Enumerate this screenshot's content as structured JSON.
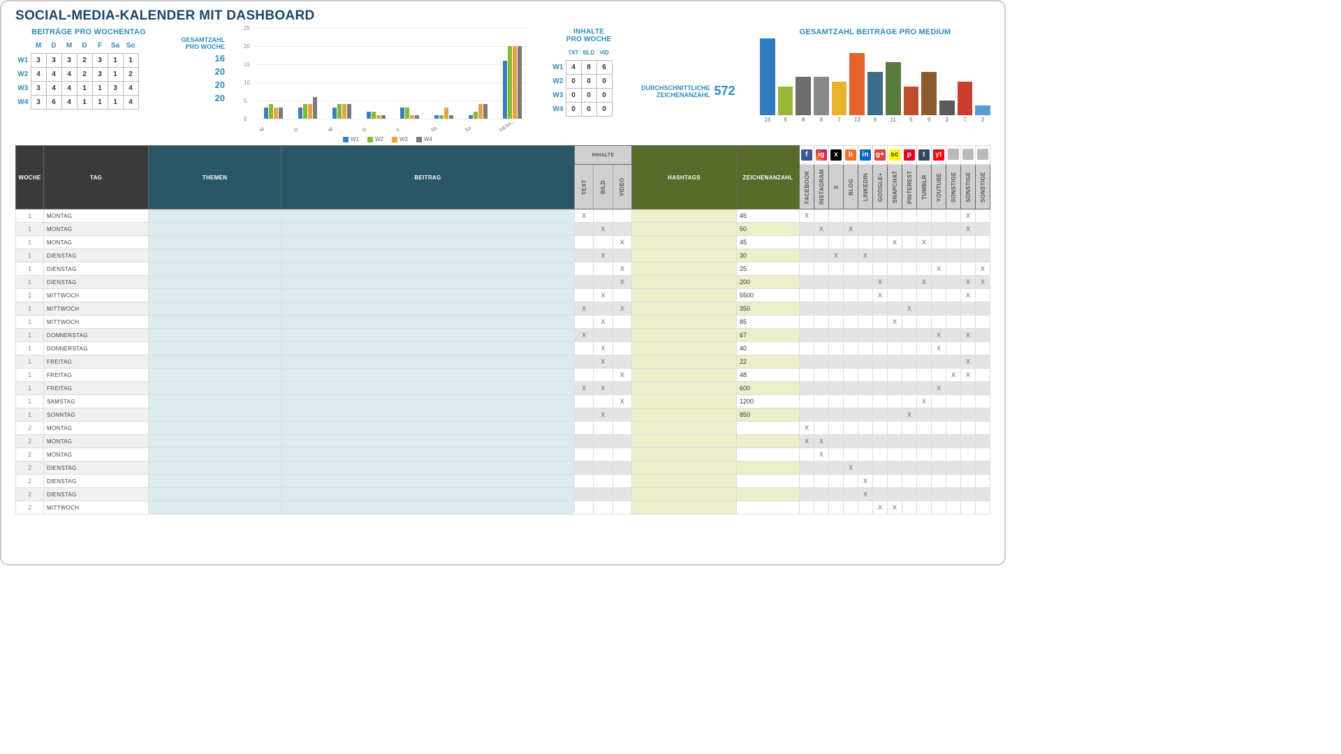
{
  "title": "SOCIAL-MEDIA-KALENDER MIT DASHBOARD",
  "weekday": {
    "title": "BEITRÄGE PRO WOCHENTAG",
    "cols": [
      "M",
      "D",
      "M",
      "D",
      "F",
      "Sa",
      "So"
    ],
    "rows": [
      {
        "label": "W1",
        "vals": [
          3,
          3,
          3,
          2,
          3,
          1,
          1
        ]
      },
      {
        "label": "W2",
        "vals": [
          4,
          4,
          4,
          2,
          3,
          1,
          2
        ]
      },
      {
        "label": "W3",
        "vals": [
          3,
          4,
          4,
          1,
          1,
          3,
          4
        ]
      },
      {
        "label": "W4",
        "vals": [
          3,
          6,
          4,
          1,
          1,
          1,
          4
        ]
      }
    ]
  },
  "totals": {
    "label": "GESAMTZAHL\nPRO WOCHE",
    "vals": [
      16,
      20,
      20,
      20
    ]
  },
  "chart_data": {
    "type": "bar",
    "title": "",
    "ylim": [
      0,
      25
    ],
    "ticks": [
      0,
      5,
      10,
      15,
      20,
      25
    ],
    "categories": [
      "M",
      "D",
      "M",
      "D",
      "F",
      "Sa",
      "So",
      "GESA..."
    ],
    "series": [
      {
        "name": "W1",
        "values": [
          3,
          3,
          3,
          2,
          3,
          1,
          1,
          16
        ]
      },
      {
        "name": "W2",
        "values": [
          4,
          4,
          4,
          2,
          3,
          1,
          2,
          20
        ]
      },
      {
        "name": "W3",
        "values": [
          3,
          4,
          4,
          1,
          1,
          3,
          4,
          20
        ]
      },
      {
        "name": "W4",
        "values": [
          3,
          6,
          4,
          1,
          1,
          1,
          4,
          20
        ]
      }
    ]
  },
  "inhalte": {
    "title": "INHALTE\nPRO WOCHE",
    "cols": [
      "TXT",
      "BLD",
      "VID"
    ],
    "rows": [
      {
        "label": "W1",
        "vals": [
          4,
          8,
          6
        ]
      },
      {
        "label": "W2",
        "vals": [
          0,
          0,
          0
        ]
      },
      {
        "label": "W3",
        "vals": [
          0,
          0,
          0
        ]
      },
      {
        "label": "W4",
        "vals": [
          0,
          0,
          0
        ]
      }
    ]
  },
  "avg": {
    "label": "DURCHSCHNITTLICHE\nZEICHENANZAHL",
    "val": "572"
  },
  "medium": {
    "title": "GESAMTZAHL BEITRÄGE PRO MEDIUM",
    "values": [
      16,
      6,
      8,
      8,
      7,
      13,
      9,
      11,
      6,
      9,
      3,
      7,
      2
    ]
  },
  "table": {
    "headers": {
      "woche": "WOCHE",
      "tag": "TAG",
      "themen": "THEMEN",
      "beitrag": "BEITRAG",
      "inhalte": "INHALTE",
      "text": "TEXT",
      "bild": "BILD",
      "video": "VIDEO",
      "hashtags": "HASHTAGS",
      "zeichen": "ZEICHENANZAHL",
      "channels": [
        "FACEBOOK",
        "INSTAGRAM",
        "X",
        "BLOG",
        "LINKEDIN",
        "GOOGLE+",
        "SNAPCHAT",
        "PINTEREST",
        "TUMBLR",
        "YOUTUBE",
        "SONSTIGE",
        "SONSTIGE",
        "SONSTIGE"
      ]
    },
    "icons": [
      "f",
      "ig",
      "x",
      "b",
      "in",
      "g+",
      "sc",
      "p",
      "t",
      "yt",
      "",
      "",
      " "
    ],
    "rows": [
      {
        "w": 1,
        "day": "MONTAG",
        "t": "X",
        "b": "",
        "v": "",
        "z": "45",
        "c": [
          "X",
          "",
          "",
          "",
          "",
          "",
          "",
          "",
          "",
          "",
          "",
          "X",
          ""
        ]
      },
      {
        "w": 1,
        "day": "MONTAG",
        "t": "",
        "b": "X",
        "v": "",
        "z": "50",
        "c": [
          "",
          "X",
          "",
          "X",
          "",
          "",
          "",
          "",
          "",
          "",
          "",
          "X",
          ""
        ]
      },
      {
        "w": 1,
        "day": "MONTAG",
        "t": "",
        "b": "",
        "v": "X",
        "z": "45",
        "c": [
          "",
          "",
          "",
          "",
          "",
          "",
          "X",
          "",
          "X",
          "",
          "",
          "",
          ""
        ]
      },
      {
        "w": 1,
        "day": "DIENSTAG",
        "t": "",
        "b": "X",
        "v": "",
        "z": "30",
        "c": [
          "",
          "",
          "X",
          "",
          "X",
          "",
          "",
          "",
          "",
          "",
          "",
          "",
          ""
        ]
      },
      {
        "w": 1,
        "day": "DIENSTAG",
        "t": "",
        "b": "",
        "v": "X",
        "z": "25",
        "c": [
          "",
          "",
          "",
          "",
          "",
          "",
          "",
          "",
          "",
          "X",
          "",
          "",
          "X"
        ]
      },
      {
        "w": 1,
        "day": "DIENSTAG",
        "t": "",
        "b": "",
        "v": "X",
        "z": "200",
        "c": [
          "",
          "",
          "",
          "",
          "",
          "X",
          "",
          "",
          "X",
          "",
          "",
          "X",
          "X"
        ]
      },
      {
        "w": 1,
        "day": "MITTWOCH",
        "t": "",
        "b": "X",
        "v": "",
        "z": "5500",
        "c": [
          "",
          "",
          "",
          "",
          "",
          "X",
          "",
          "",
          "",
          "",
          "",
          "X",
          ""
        ]
      },
      {
        "w": 1,
        "day": "MITTWOCH",
        "t": "X",
        "b": "",
        "v": "X",
        "z": "350",
        "c": [
          "",
          "",
          "",
          "",
          "",
          "",
          "",
          "X",
          "",
          "",
          "",
          "",
          ""
        ]
      },
      {
        "w": 1,
        "day": "MITTWOCH",
        "t": "",
        "b": "X",
        "v": "",
        "z": "85",
        "c": [
          "",
          "",
          "",
          "",
          "",
          "",
          "X",
          "",
          "",
          "",
          "",
          "",
          ""
        ]
      },
      {
        "w": 1,
        "day": "DONNERSTAG",
        "t": "X",
        "b": "",
        "v": "",
        "z": "67",
        "c": [
          "",
          "",
          "",
          "",
          "",
          "",
          "",
          "",
          "",
          "X",
          "",
          "X",
          ""
        ]
      },
      {
        "w": 1,
        "day": "DONNERSTAG",
        "t": "",
        "b": "X",
        "v": "",
        "z": "40",
        "c": [
          "",
          "",
          "",
          "",
          "",
          "",
          "",
          "",
          "",
          "X",
          "",
          "",
          ""
        ]
      },
      {
        "w": 1,
        "day": "FREITAG",
        "t": "",
        "b": "X",
        "v": "",
        "z": "22",
        "c": [
          "",
          "",
          "",
          "",
          "",
          "",
          "",
          "",
          "",
          "",
          "",
          "X",
          ""
        ]
      },
      {
        "w": 1,
        "day": "FREITAG",
        "t": "",
        "b": "",
        "v": "X",
        "z": "48",
        "c": [
          "",
          "",
          "",
          "",
          "",
          "",
          "",
          "",
          "",
          "",
          "X",
          "X",
          ""
        ]
      },
      {
        "w": 1,
        "day": "FREITAG",
        "t": "X",
        "b": "X",
        "v": "",
        "z": "600",
        "c": [
          "",
          "",
          "",
          "",
          "",
          "",
          "",
          "",
          "",
          "X",
          "",
          "",
          ""
        ]
      },
      {
        "w": 1,
        "day": "SAMSTAG",
        "t": "",
        "b": "",
        "v": "X",
        "z": "1200",
        "c": [
          "",
          "",
          "",
          "",
          "",
          "",
          "",
          "",
          "X",
          "",
          "",
          "",
          ""
        ]
      },
      {
        "w": 1,
        "day": "SONNTAG",
        "t": "",
        "b": "X",
        "v": "",
        "z": "850",
        "c": [
          "",
          "",
          "",
          "",
          "",
          "",
          "",
          "X",
          "",
          "",
          "",
          "",
          ""
        ]
      },
      {
        "w": 2,
        "day": "MONTAG",
        "t": "",
        "b": "",
        "v": "",
        "z": "",
        "c": [
          "X",
          "",
          "",
          "",
          "",
          "",
          "",
          "",
          "",
          "",
          "",
          "",
          ""
        ]
      },
      {
        "w": 2,
        "day": "MONTAG",
        "t": "",
        "b": "",
        "v": "",
        "z": "",
        "c": [
          "X",
          "X",
          "",
          "",
          "",
          "",
          "",
          "",
          "",
          "",
          "",
          "",
          ""
        ]
      },
      {
        "w": 2,
        "day": "MONTAG",
        "t": "",
        "b": "",
        "v": "",
        "z": "",
        "c": [
          "",
          "X",
          "",
          "",
          "",
          "",
          "",
          "",
          "",
          "",
          "",
          "",
          ""
        ]
      },
      {
        "w": 2,
        "day": "DIENSTAG",
        "t": "",
        "b": "",
        "v": "",
        "z": "",
        "c": [
          "",
          "",
          "",
          "X",
          "",
          "",
          "",
          "",
          "",
          "",
          "",
          "",
          ""
        ]
      },
      {
        "w": 2,
        "day": "DIENSTAG",
        "t": "",
        "b": "",
        "v": "",
        "z": "",
        "c": [
          "",
          "",
          "",
          "",
          "X",
          "",
          "",
          "",
          "",
          "",
          "",
          "",
          ""
        ]
      },
      {
        "w": 2,
        "day": "DIENSTAG",
        "t": "",
        "b": "",
        "v": "",
        "z": "",
        "c": [
          "",
          "",
          "",
          "",
          "X",
          "",
          "",
          "",
          "",
          "",
          "",
          "",
          ""
        ]
      },
      {
        "w": 2,
        "day": "MITTWOCH",
        "t": "",
        "b": "",
        "v": "",
        "z": "",
        "c": [
          "",
          "",
          "",
          "",
          "",
          "X",
          "X",
          "",
          "",
          "",
          "",
          "",
          ""
        ]
      }
    ]
  }
}
